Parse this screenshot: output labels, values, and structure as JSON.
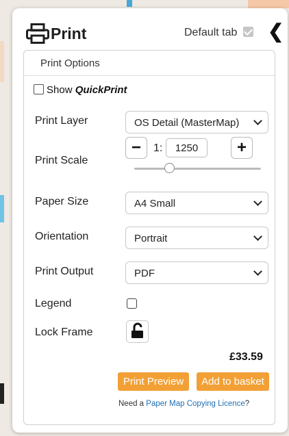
{
  "header": {
    "title": "Print",
    "default_tab_label": "Default tab",
    "default_tab_checked": true
  },
  "options": {
    "section_title": "Print Options",
    "quickprint": {
      "prefix": "Show ",
      "brand": "QuickPrint",
      "checked": false
    },
    "print_layer": {
      "label": "Print Layer",
      "value": "OS Detail (MasterMap)"
    },
    "print_scale": {
      "label": "Print Scale",
      "prefix": "1:",
      "value": "1250",
      "minus": "−",
      "plus": "+"
    },
    "paper_size": {
      "label": "Paper Size",
      "value": "A4 Small"
    },
    "orientation": {
      "label": "Orientation",
      "value": "Portrait"
    },
    "print_output": {
      "label": "Print Output",
      "value": "PDF"
    },
    "legend": {
      "label": "Legend",
      "checked": false
    },
    "lock_frame": {
      "label": "Lock Frame",
      "icon": "unlock-icon"
    },
    "price": "£33.59",
    "preview_button": "Print Preview",
    "basket_button": "Add to basket",
    "licence_text": "Need a ",
    "licence_link": "Paper Map Copying Licence",
    "licence_suffix": "?"
  },
  "colors": {
    "accent": "#f2a035",
    "link": "#1f6fb3"
  }
}
